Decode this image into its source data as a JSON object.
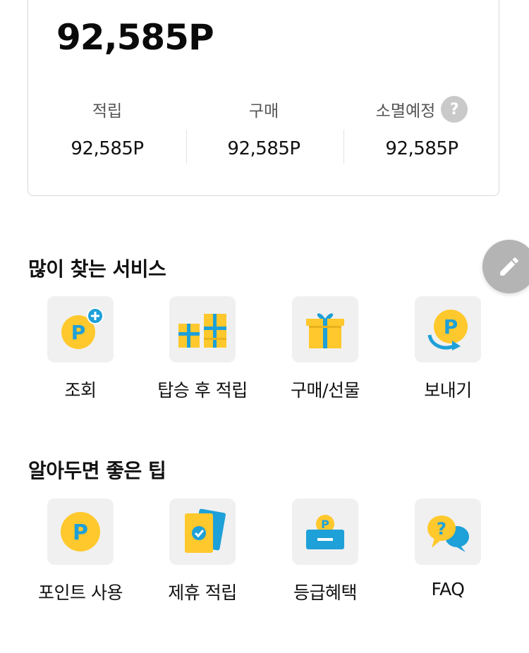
{
  "points": {
    "total": "92,585P",
    "stats": [
      {
        "label": "적립",
        "value": "92,585P"
      },
      {
        "label": "구매",
        "value": "92,585P"
      },
      {
        "label": "소멸예정",
        "value": "92,585P"
      }
    ],
    "help_icon": "?"
  },
  "services": {
    "title": "많이 찾는 서비스",
    "items": [
      {
        "label": "조회",
        "icon": "point-coin-plus-icon"
      },
      {
        "label": "탑승 후 적립",
        "icon": "gift-boxes-icon"
      },
      {
        "label": "구매/선물",
        "icon": "gift-box-icon"
      },
      {
        "label": "보내기",
        "icon": "send-point-icon"
      }
    ]
  },
  "tips": {
    "title": "알아두면 좋은 팁",
    "items": [
      {
        "label": "포인트 사용",
        "icon": "point-coin-icon"
      },
      {
        "label": "제휴 적립",
        "icon": "partner-card-check-icon"
      },
      {
        "label": "등급혜택",
        "icon": "wallet-coin-icon"
      },
      {
        "label": "FAQ",
        "icon": "chat-question-icon"
      }
    ]
  },
  "colors": {
    "accent_yellow": "#ffc82c",
    "accent_blue": "#1ea0d8",
    "tile_bg": "#f0f0f0",
    "fab_bg": "#b4b4b4"
  },
  "fab": {
    "icon": "pencil-icon"
  }
}
